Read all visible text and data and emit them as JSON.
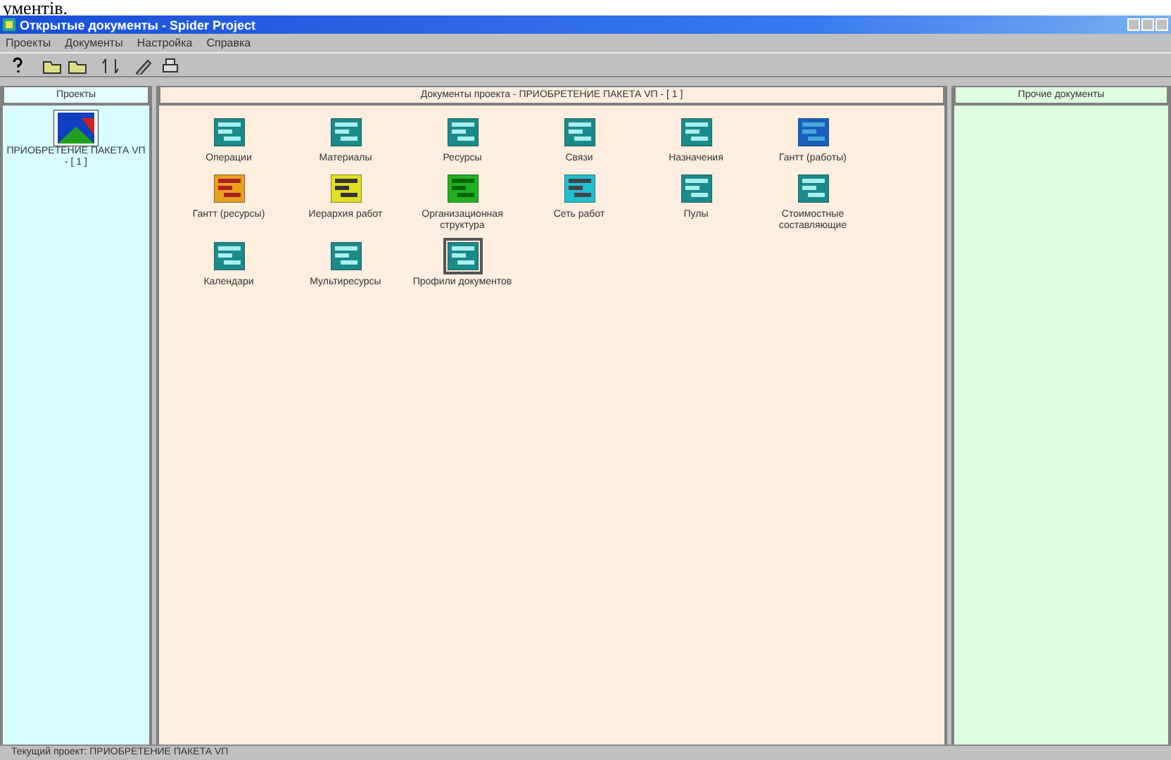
{
  "page_fragment": "ументів.",
  "window": {
    "title": "Открытые документы - Spider Project"
  },
  "menu": [
    "Проекты",
    "Документы",
    "Настройка",
    "Справка"
  ],
  "toolbar": [
    {
      "kind": "help"
    },
    {
      "kind": "open"
    },
    {
      "kind": "open"
    },
    {
      "kind": "sort"
    },
    {
      "kind": "edit"
    },
    {
      "kind": "print"
    }
  ],
  "projects_panel": {
    "title": "Проекты",
    "items": [
      {
        "label": "ПРИОБРЕТЕНИЕ ПАКЕТА VП - [ 1 ]",
        "selected": true
      }
    ]
  },
  "documents_panel": {
    "title": "Документы проекта - ПРИОБРЕТЕНИЕ ПАКЕТА VП - [ 1 ]",
    "items": [
      {
        "label": "Операции",
        "kind": "table",
        "selected": false
      },
      {
        "label": "Материалы",
        "kind": "table",
        "selected": false
      },
      {
        "label": "Ресурсы",
        "kind": "table",
        "selected": false
      },
      {
        "label": "Связи",
        "kind": "table",
        "selected": false
      },
      {
        "label": "Назначения",
        "kind": "table",
        "selected": false
      },
      {
        "label": "Гантт (работы)",
        "kind": "gantt",
        "selected": false
      },
      {
        "label": "Гантт (ресурсы)",
        "kind": "resource-gantt",
        "selected": false
      },
      {
        "label": "Иерархия работ",
        "kind": "hierarchy",
        "selected": false
      },
      {
        "label": "Организационная структура",
        "kind": "org",
        "selected": false
      },
      {
        "label": "Сеть работ",
        "kind": "network",
        "selected": false
      },
      {
        "label": "Пулы",
        "kind": "table",
        "selected": false
      },
      {
        "label": "Стоимостные составляющие",
        "kind": "table",
        "selected": false
      },
      {
        "label": "Календари",
        "kind": "table",
        "selected": false
      },
      {
        "label": "Мультиресурсы",
        "kind": "table",
        "selected": false
      },
      {
        "label": "Профили документов",
        "kind": "table",
        "selected": true
      }
    ]
  },
  "other_panel": {
    "title": "Прочие документы"
  },
  "status_bar": "Текущий проект: ПРИОБРЕТЕНИЕ ПАКЕТА VП"
}
